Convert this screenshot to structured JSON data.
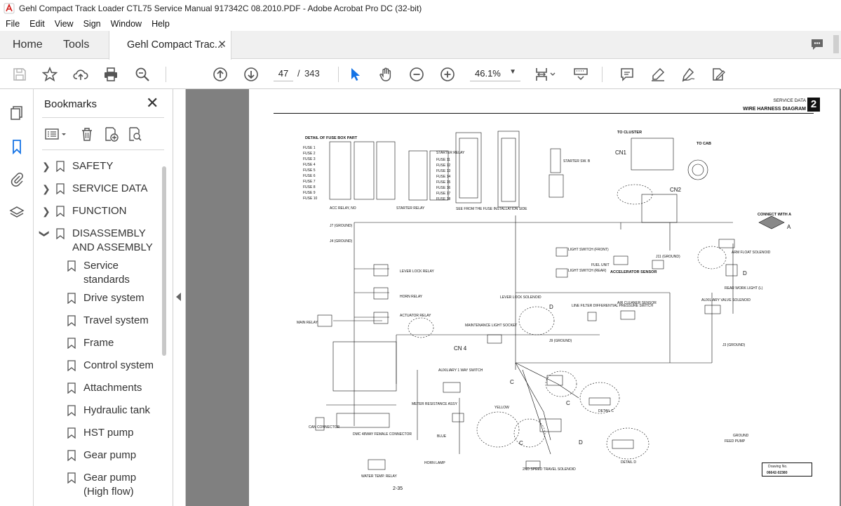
{
  "window": {
    "title": "Gehl Compact Track Loader CTL75 Service Manual 917342C 08.2010.PDF - Adobe Acrobat Pro DC (32-bit)"
  },
  "menu": [
    "File",
    "Edit",
    "View",
    "Sign",
    "Window",
    "Help"
  ],
  "tabs": {
    "home": "Home",
    "tools": "Tools",
    "document": "Gehl Compact Trac..."
  },
  "toolbar": {
    "current_page": "47",
    "page_separator": "/",
    "total_pages": "343",
    "zoom": "46.1%"
  },
  "bookmarks": {
    "header": "Bookmarks",
    "items": [
      {
        "label": "SAFETY",
        "level": 0,
        "expanded": false
      },
      {
        "label": "SERVICE DATA",
        "level": 0,
        "expanded": false
      },
      {
        "label": "FUNCTION",
        "level": 0,
        "expanded": false
      },
      {
        "label": "DISASSEMBLY AND ASSEMBLY",
        "level": 0,
        "expanded": true
      },
      {
        "label": "Service standards",
        "level": 1
      },
      {
        "label": "Drive system",
        "level": 1
      },
      {
        "label": "Travel system",
        "level": 1
      },
      {
        "label": "Frame",
        "level": 1
      },
      {
        "label": "Control system",
        "level": 1
      },
      {
        "label": "Attachments",
        "level": 1
      },
      {
        "label": "Hydraulic tank",
        "level": 1
      },
      {
        "label": "HST pump",
        "level": 1
      },
      {
        "label": "Gear pump",
        "level": 1
      },
      {
        "label": "Gear pump (High flow)",
        "level": 1
      }
    ]
  },
  "document_page": {
    "header_section": "SERVICE DATA",
    "header_title": "WIRE HARNESS DIAGRAM",
    "section_number": "2",
    "page_number": "2-35",
    "drawing_no_label": "Drawing No.",
    "drawing_no_value": "06642-02380",
    "labels": {
      "fuse_box": "DETAIL OF FUSE BOX PART",
      "fuses_left": [
        "FUSE 1",
        "FUSE 2",
        "FUSE 3",
        "FUSE 4",
        "FUSE 5",
        "FUSE 6",
        "FUSE 7",
        "FUSE 8",
        "FUSE 9",
        "FUSE 10"
      ],
      "fuses_right": [
        "STARTER RELAY",
        "FUSE 11",
        "FUSE 12",
        "FUSE 13",
        "FUSE 14",
        "FUSE 15",
        "FUSE 16",
        "FUSE 17",
        "FUSE 18"
      ],
      "acc_relay": "ACC RELAY, NO",
      "starter_relay": "STARTER RELAY",
      "see_from_fuse": "SEE FROM THE FUSE INSTALLATION SIDE",
      "starter_sw": "STARTER SW. B",
      "to_cluster": "TO CLUSTER",
      "cn1": "CN1",
      "cn2": "CN2",
      "to_cab": "TO CAB",
      "connect_with": "CONNECT WITH A",
      "connect_letter": "A",
      "j7_ground": "J7 (GROUND)",
      "j4_ground": "J4 (GROUND)",
      "light_switch_front": "LIGHT SWITCH (FRONT)",
      "light_switch_rear": "LIGHT SWITCH (REAR)",
      "fuel_unit": "FUEL UNIT",
      "accel_sensor": "ACCELERATOR SENSOR",
      "arm_float": "ARM FLOAT SOLENOID",
      "lever_lock_relay": "LEVER LOCK RELAY",
      "horn_relay": "HORN RELAY",
      "actuator_relay": "ACTUATOR RELAY",
      "main_relay": "MAIN RELAY",
      "rear_work_light": "REAR WORK LIGHT (L)",
      "lever_lock_solenoid": "LEVER LOCK SOLENOID",
      "line_filter": "LINE FILTER DIFFERENTIAL PRESSURE SWITCH",
      "air_cleaner": "AIR CLEANER SENSOR",
      "aux_valve": "AUXILIARY VALVE SOLENOID",
      "maint_socket": "MAINTENANCE LIGHT SOCKET",
      "cn4": "CN 4",
      "aux_way_sw": "AUXILIARY 1 WAY SWITCH",
      "meter_res": "METER RESISTANCE ASSY",
      "yellow": "YELLOW",
      "blue": "BLUE",
      "ground": "GROUND",
      "feed_pump": "FEED PUMP",
      "horn_lamp": "HORN LAMP",
      "water_temp": "WATER TEMP. RELAY",
      "second_speed": "2ND SPEED TRAVEL SOLENOID",
      "detail_c": "DETAIL C",
      "detail_d": "DETAIL D",
      "j9_ground": "J9 (GROUND)",
      "j11_ground": "J11 (GROUND)",
      "j3_ground": "J3 (GROUND)",
      "can_connector": "CAN CONNECTOR",
      "dmc_female": "DMC 48WAY FEMALE CONNECTOR",
      "letter_c": "C",
      "letter_d": "D"
    }
  },
  "colors": {
    "accent_red": "#d2201c",
    "active_blue": "#1473e6",
    "viewer_bg": "#808080"
  }
}
